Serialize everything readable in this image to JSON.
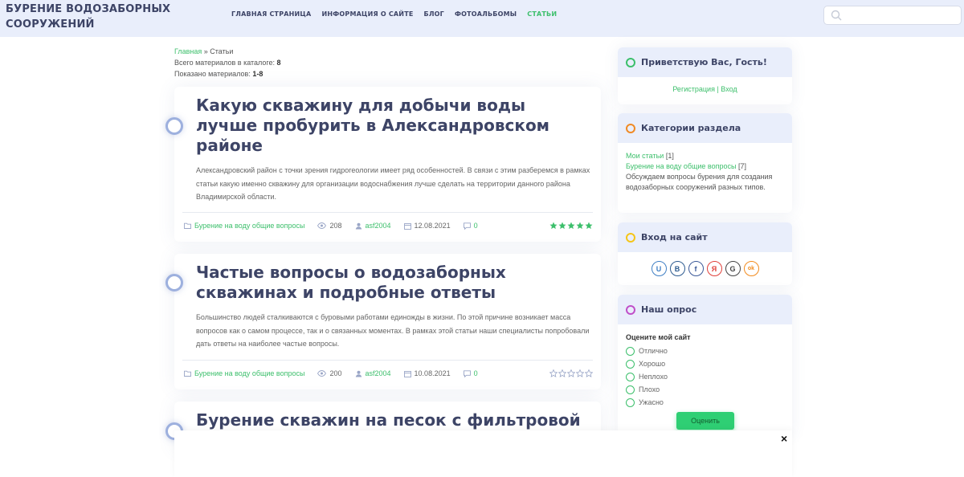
{
  "header": {
    "site_title_line1": "БУРЕНИЕ ВОДОЗАБОРНЫХ",
    "site_title_line2": "СООРУЖЕНИЙ",
    "nav": [
      "ГЛАВНАЯ СТРАНИЦА",
      "ИНФОРМАЦИЯ О САЙТЕ",
      "БЛОГ",
      "ФОТОАЛЬБОМЫ",
      "СТАТЬИ"
    ],
    "search_placeholder": ""
  },
  "breadcrumb": {
    "home": "Главная",
    "separator": " » ",
    "current": "Статьи",
    "total_label": "Всего материалов в каталоге: ",
    "total_value": "8",
    "shown_label": "Показано материалов: ",
    "shown_value": "1-8"
  },
  "entries": [
    {
      "title": "Какую скважину для добычи воды лучше пробурить в Александровском районе",
      "text": "Александровский район с точки зрения гидрогеологии имеет ряд особенностей. В связи с этим разберемся в рамках статьи какую именно скважину для организации водоснабжения лучше сделать на территории данного района Владимирской области.",
      "category": "Бурение на воду общие вопросы",
      "views": "208",
      "author": "asf2004",
      "date": "12.08.2021",
      "comments": "0",
      "rating": 5
    },
    {
      "title": "Частые вопросы о водозаборных скважинах и подробные ответы",
      "text": "Большинство людей сталкиваются с буровыми работами единожды в жизни. По этой причине возникает масса вопросов как о самом процессе, так и о связанных моментах. В рамках этой статьи наши специалисты попробовали дать ответы на наиболее частые вопросы.",
      "category": "Бурение на воду общие вопросы",
      "views": "200",
      "author": "asf2004",
      "date": "10.08.2021",
      "comments": "0",
      "rating": 0
    },
    {
      "title": "Бурение скважин на песок с фильтровой"
    }
  ],
  "sidebar": {
    "welcome": {
      "title": "Приветствую Вас, Гость!",
      "register": "Регистрация",
      "sep": " | ",
      "login": "Вход"
    },
    "categories": {
      "title": "Категории раздела",
      "items": [
        {
          "label": "Мои статьи",
          "count": " [1]"
        },
        {
          "label": "Бурение на воду общие вопросы",
          "count": " [7]"
        }
      ],
      "description": "Обсуждаем вопросы бурения для создания водозаборных сооружений разных типов."
    },
    "login": {
      "title": "Вход на сайт",
      "icons": [
        "U",
        "B",
        "f",
        "Я",
        "G",
        "ok"
      ]
    },
    "poll": {
      "title": "Наш опрос",
      "question": "Оцените мой сайт",
      "options": [
        "Отлично",
        "Хорошо",
        "Неплохо",
        "Плохо",
        "Ужасно"
      ],
      "button": "Оценить"
    }
  },
  "overlay": {
    "close": "×"
  },
  "colors": {
    "accent": "#3cbf6b",
    "header_bg": "#e9eefb",
    "title_text": "#3d4466",
    "ring_welcome": "#3cbf6b",
    "ring_categories": "#f08a24",
    "ring_login": "#f5c518",
    "ring_poll": "#c04fc9"
  }
}
